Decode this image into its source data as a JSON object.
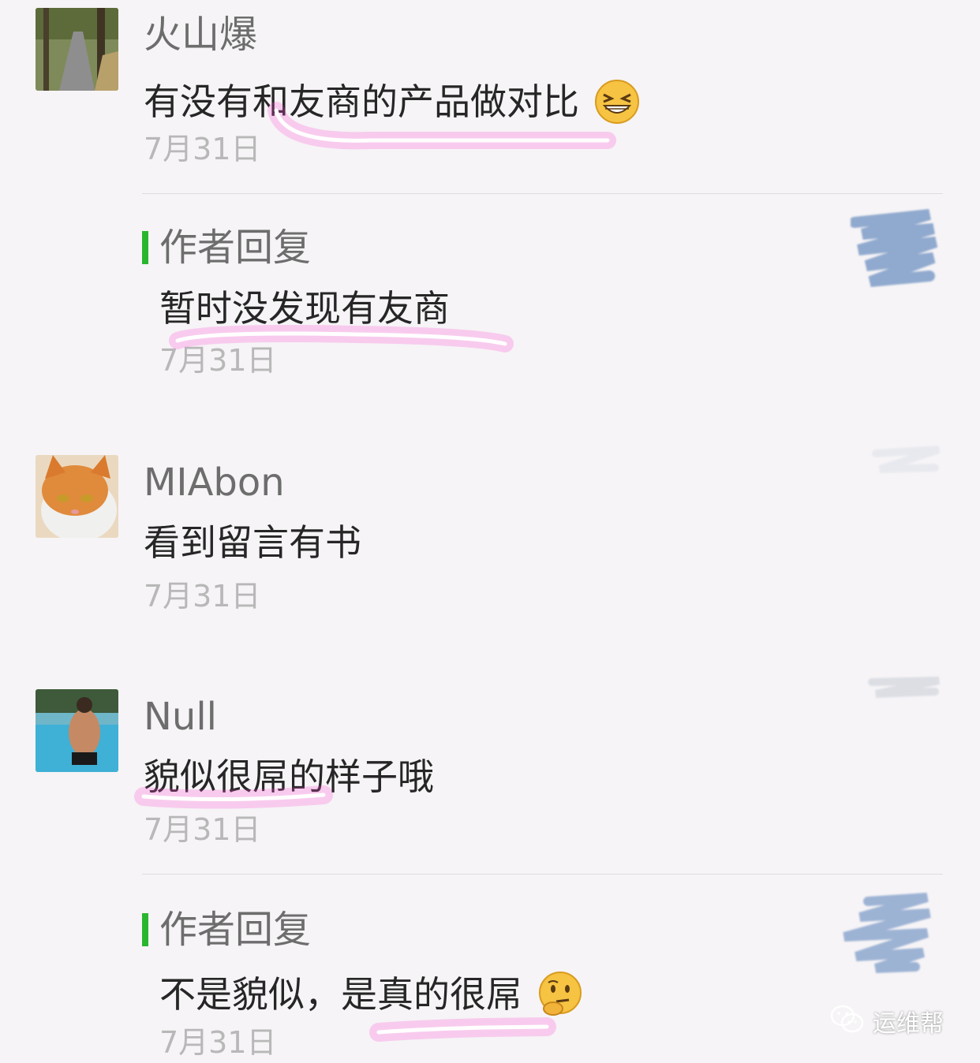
{
  "comments": [
    {
      "name": "火山爆",
      "text": "有没有和友商的产品做对比",
      "date": "7月31日",
      "reply": {
        "label": "作者回复",
        "text": "暂时没发现有友商",
        "date": "7月31日"
      }
    },
    {
      "name": "MIAbon",
      "text": "看到留言有书",
      "date": "7月31日"
    },
    {
      "name": "Null",
      "text": "貌似很屌的样子哦",
      "date": "7月31日",
      "reply": {
        "label": "作者回复",
        "text": "不是貌似，是真的很屌",
        "date": "7月31日"
      }
    }
  ],
  "watermark": {
    "text": "运维帮",
    "icon": "wechat-icon"
  },
  "colors": {
    "reply_bar": "#2ab52f",
    "highlight": "#ff4fd8",
    "scribble": "#7f9dc8"
  }
}
